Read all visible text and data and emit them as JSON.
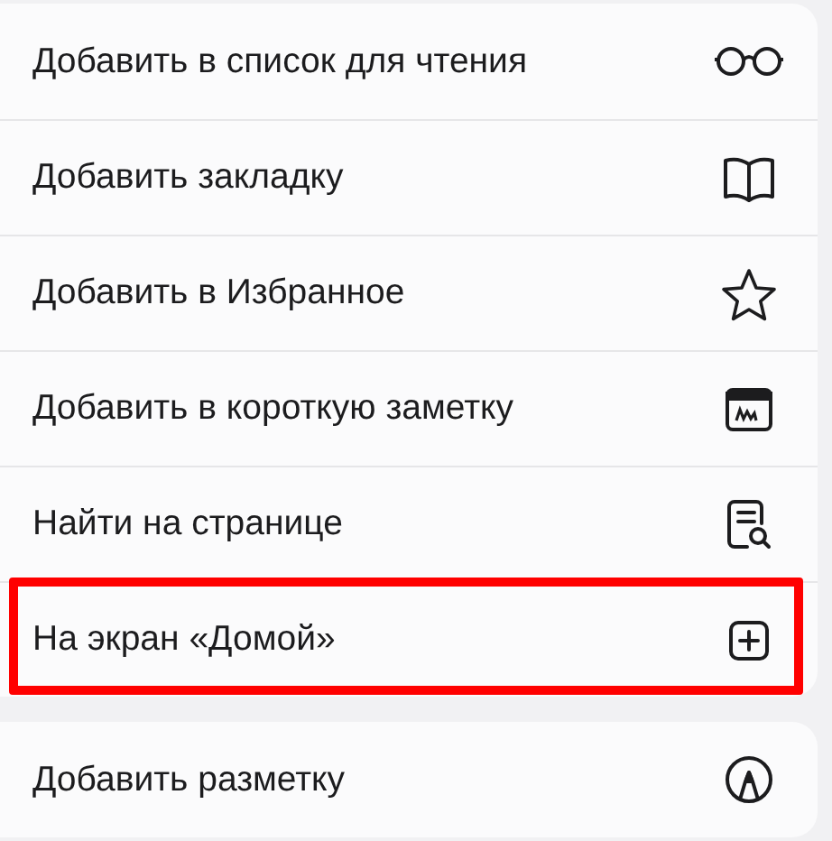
{
  "menu_groups": [
    {
      "items": [
        {
          "label": "Добавить в список для чтения",
          "highlighted": false
        },
        {
          "label": "Добавить закладку",
          "highlighted": false
        },
        {
          "label": "Добавить в Избранное",
          "highlighted": false
        },
        {
          "label": "Добавить в короткую заметку",
          "highlighted": false
        },
        {
          "label": "Найти на странице",
          "highlighted": false
        },
        {
          "label": "На экран «Домой»",
          "highlighted": true
        }
      ]
    },
    {
      "items": [
        {
          "label": "Добавить разметку",
          "highlighted": false
        }
      ]
    }
  ]
}
